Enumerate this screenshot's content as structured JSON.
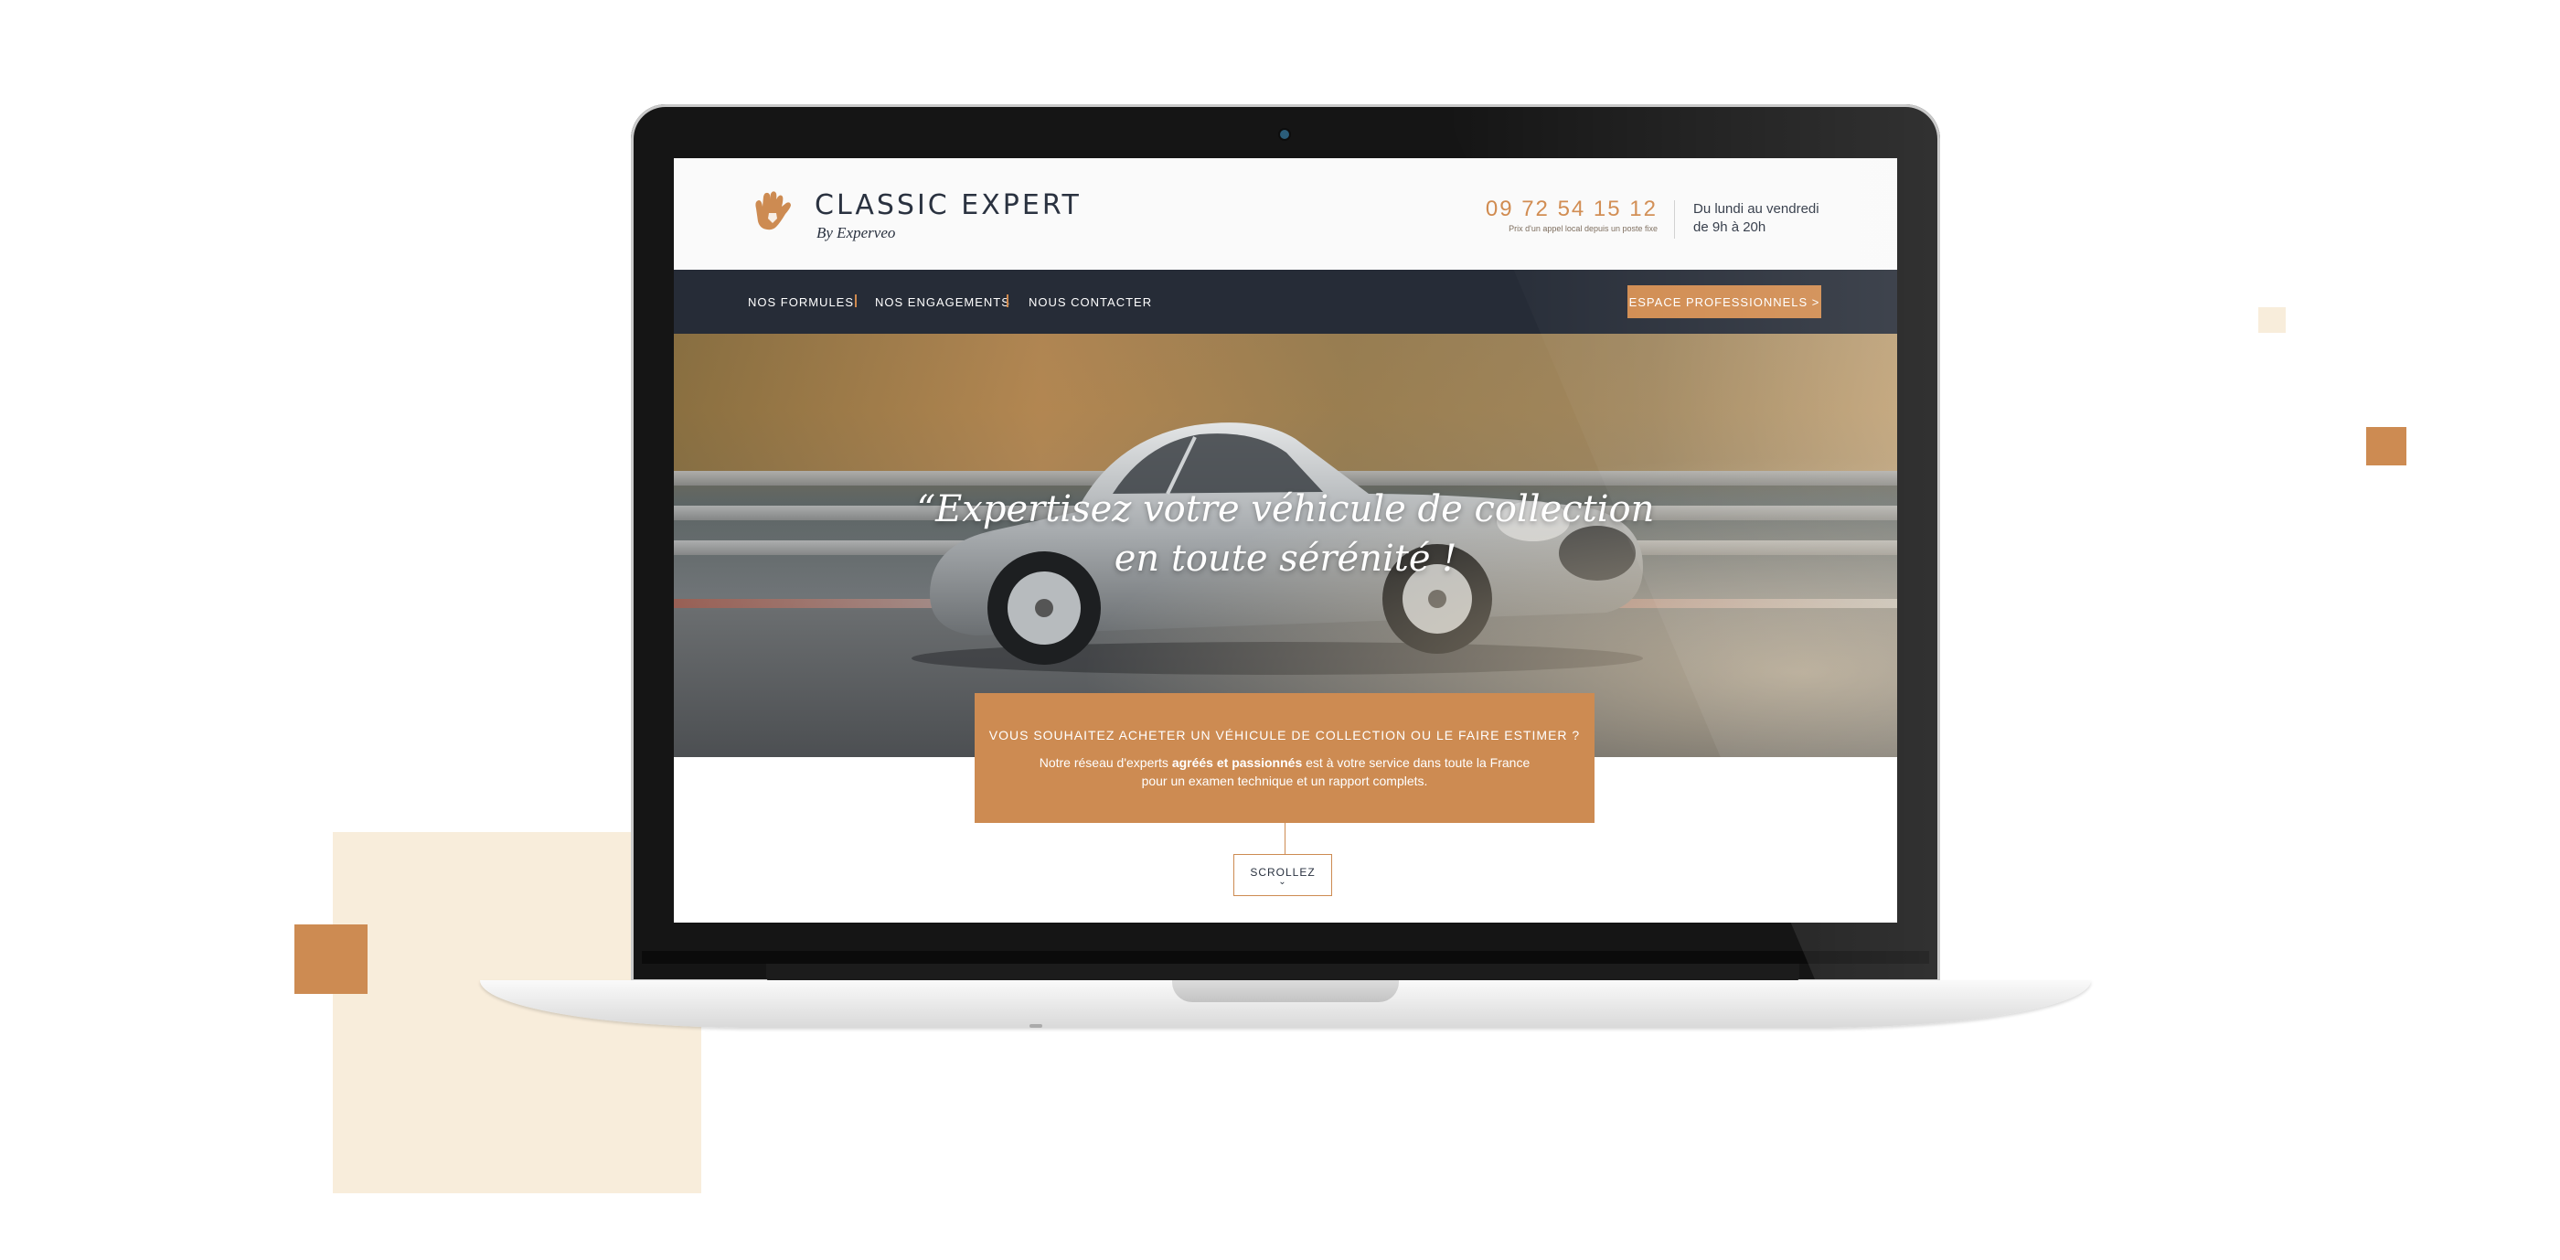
{
  "brand": {
    "name": "CLASSIC EXPERT",
    "byline": "By Experveo",
    "logo_icon": "hand-icon"
  },
  "contact": {
    "phone": "09 72 54 15 12",
    "phone_note": "Prix d'un appel local depuis un poste fixe",
    "hours_line1": "Du lundi au vendredi",
    "hours_line2": "de 9h à 20h"
  },
  "nav": {
    "items": [
      {
        "label": "NOS FORMULES"
      },
      {
        "label": "NOS ENGAGEMENTS"
      },
      {
        "label": "NOUS CONTACTER"
      }
    ],
    "pro_button": "ESPACE PROFESSIONNELS >"
  },
  "hero": {
    "title_line1": "“Expertisez votre véhicule de collection",
    "title_line2": "en toute sérénité !"
  },
  "cta": {
    "title": "VOUS SOUHAITEZ ACHETER UN VÉHICULE DE COLLECTION OU LE FAIRE ESTIMER ?",
    "text_before": "Notre réseau d'experts ",
    "text_bold": "agréés et passionnés",
    "text_after": " est à votre service dans toute la France pour un examen technique et un rapport complets."
  },
  "scroll": {
    "label": "SCROLLEZ",
    "icon": "chevron-down-icon"
  },
  "colors": {
    "accent": "#cd8b52",
    "nav_bg": "#262c37",
    "deco_beige": "#f8eddb",
    "text_dark": "#2a3240"
  }
}
